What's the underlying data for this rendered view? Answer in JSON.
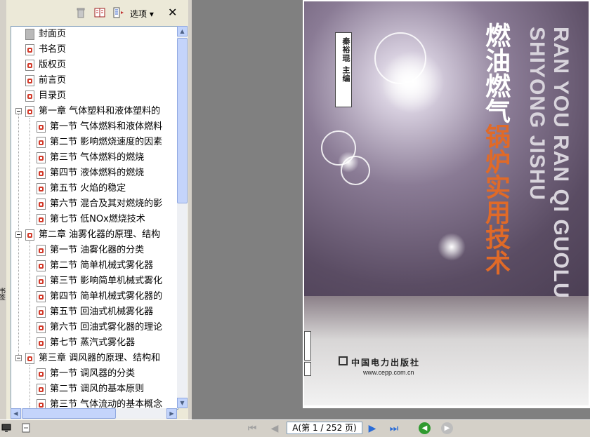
{
  "nav_toolbar": {
    "options_label": "选项 ▾",
    "close_label": "✕"
  },
  "bookmarks": [
    {
      "label": "封面页",
      "level": 1,
      "icon": "page-gray-icon"
    },
    {
      "label": "书名页",
      "level": 1,
      "icon": "pdf-bookmark-icon"
    },
    {
      "label": "版权页",
      "level": 1,
      "icon": "pdf-bookmark-icon"
    },
    {
      "label": "前言页",
      "level": 1,
      "icon": "pdf-bookmark-icon"
    },
    {
      "label": "目录页",
      "level": 1,
      "icon": "pdf-bookmark-icon"
    },
    {
      "label": "第一章 气体塑料和液体塑料的",
      "level": 1,
      "icon": "pdf-bookmark-icon",
      "expanded": true
    },
    {
      "label": "第一节 气体燃料和液体燃料",
      "level": 2,
      "icon": "pdf-bookmark-icon"
    },
    {
      "label": "第二节 影响燃烧速度的因素",
      "level": 2,
      "icon": "pdf-bookmark-icon"
    },
    {
      "label": "第三节 气体燃料的燃烧",
      "level": 2,
      "icon": "pdf-bookmark-icon"
    },
    {
      "label": "第四节 液体燃料的燃烧",
      "level": 2,
      "icon": "pdf-bookmark-icon"
    },
    {
      "label": "第五节 火焰的稳定",
      "level": 2,
      "icon": "pdf-bookmark-icon"
    },
    {
      "label": "第六节 混合及其对燃烧的影",
      "level": 2,
      "icon": "pdf-bookmark-icon"
    },
    {
      "label": "第七节 低NOx燃烧技术",
      "level": 2,
      "icon": "pdf-bookmark-icon"
    },
    {
      "label": "第二章 油雾化器的原理、结构",
      "level": 1,
      "icon": "pdf-bookmark-icon",
      "expanded": true
    },
    {
      "label": "第一节 油雾化器的分类",
      "level": 2,
      "icon": "pdf-bookmark-icon"
    },
    {
      "label": "第二节 简单机械式雾化器",
      "level": 2,
      "icon": "pdf-bookmark-icon"
    },
    {
      "label": "第三节 影响简单机械式雾化",
      "level": 2,
      "icon": "pdf-bookmark-icon"
    },
    {
      "label": "第四节 简单机械式雾化器的",
      "level": 2,
      "icon": "pdf-bookmark-icon"
    },
    {
      "label": "第五节 回油式机械雾化器",
      "level": 2,
      "icon": "pdf-bookmark-icon"
    },
    {
      "label": "第六节 回油式雾化器的理论",
      "level": 2,
      "icon": "pdf-bookmark-icon"
    },
    {
      "label": "第七节 蒸汽式雾化器",
      "level": 2,
      "icon": "pdf-bookmark-icon"
    },
    {
      "label": "第三章 调风器的原理、结构和",
      "level": 1,
      "icon": "pdf-bookmark-icon",
      "expanded": true
    },
    {
      "label": "第一节 调风器的分类",
      "level": 2,
      "icon": "pdf-bookmark-icon"
    },
    {
      "label": "第二节 调风的基本原则",
      "level": 2,
      "icon": "pdf-bookmark-icon"
    },
    {
      "label": "第三节 气体流动的基本概念",
      "level": 2,
      "icon": "pdf-bookmark-icon"
    }
  ],
  "cover": {
    "author": "秦裕琨 主编",
    "title_part1": "燃油燃气",
    "title_part2": "锅炉实用技术",
    "pinyin": "RAN YOU RAN QI GUOLU SHIYONG JISHU",
    "publisher": "中国电力出版社",
    "publisher_url": "www.cepp.com.cn",
    "title_color": "#ffffff",
    "accent_color": "#e06a28"
  },
  "statusbar": {
    "page_display": "A(第 1 / 252 页)"
  },
  "side_tabs": {
    "label": "书签"
  }
}
